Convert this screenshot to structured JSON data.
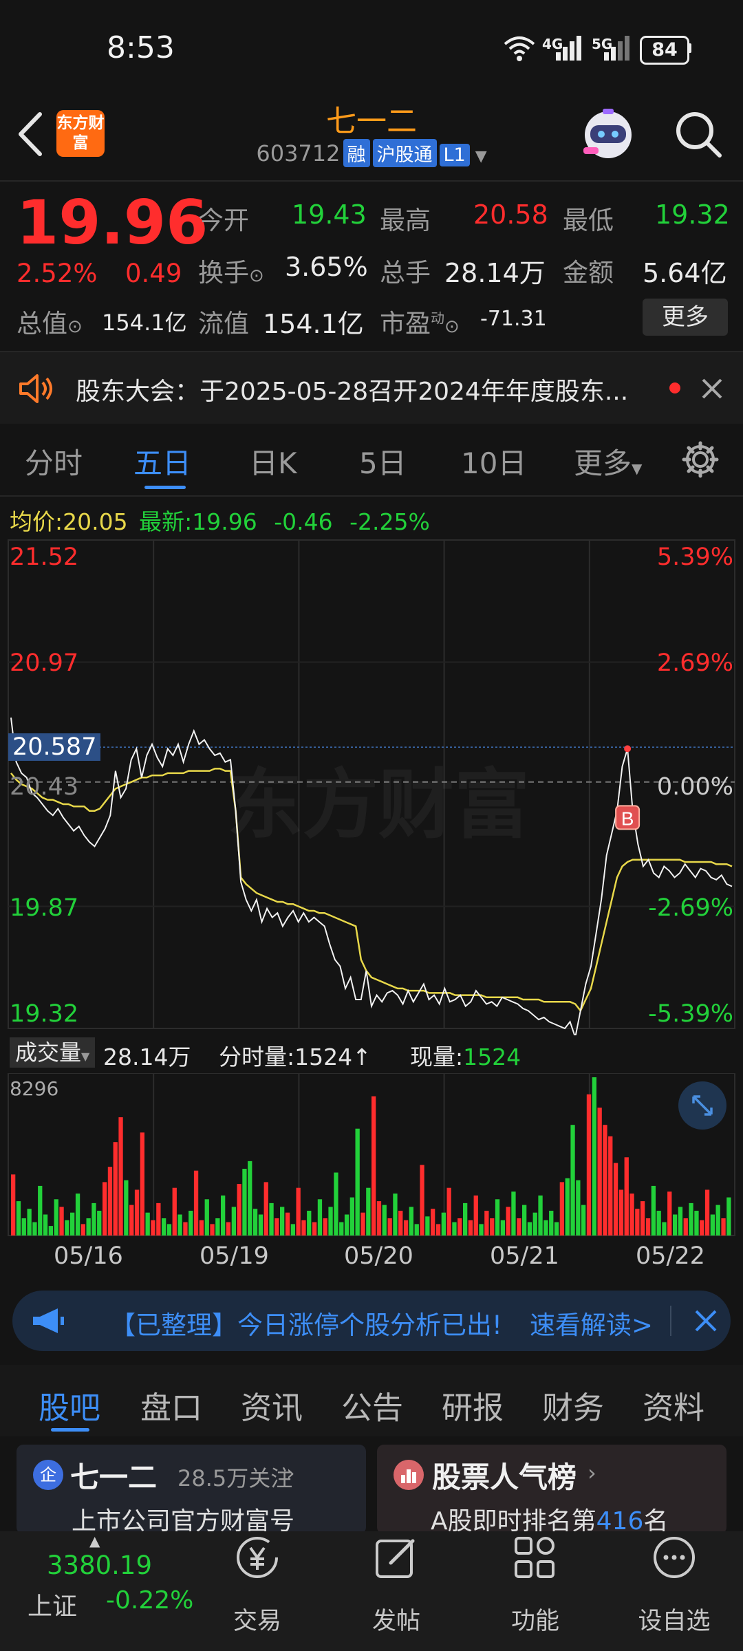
{
  "status_bar": {
    "time": "8:53",
    "battery": "84",
    "net1": "4G",
    "net2": "5G"
  },
  "header": {
    "stock_name": "七一二",
    "code": "603712",
    "tags": [
      "融",
      "沪股通",
      "L1"
    ],
    "logo_text": "东方财富"
  },
  "quote": {
    "price": "19.96",
    "change_pct": "2.52%",
    "change": "0.49",
    "fields": [
      {
        "label": "今开",
        "value": "19.43"
      },
      {
        "label": "最高",
        "value": "20.58"
      },
      {
        "label": "最低",
        "value": "19.32"
      },
      {
        "label": "换手",
        "value": "3.65%"
      },
      {
        "label": "总手",
        "value": "28.14万"
      },
      {
        "label": "金额",
        "value": "5.64亿"
      },
      {
        "label": "总值",
        "value": "154.1亿"
      },
      {
        "label": "流值",
        "value": "154.1亿"
      },
      {
        "label": "市盈",
        "sup": "动",
        "value": "-71.31"
      }
    ],
    "more_button": "更多"
  },
  "notice": {
    "text": "股东大会：于2025-05-28召开2024年年度股东..."
  },
  "chart_tabs": [
    "分时",
    "五日",
    "日K",
    "5日",
    "10日",
    "更多"
  ],
  "chart_tabs_active": "五日",
  "info_line": {
    "avg_label": "均价:",
    "avg_value": "20.05",
    "latest_label": "最新:",
    "latest_value": "19.96",
    "chg": "-0.46",
    "chg_pct": "-2.25%"
  },
  "watermark": "东方财富",
  "volume_header": {
    "dropdown": "成交量",
    "total": "28.14万",
    "tick_label": "分时量:1524↑",
    "now_label": "现量:",
    "now_value": "1524",
    "max_label": "8296"
  },
  "promo": {
    "text": "【已整理】今日涨停个股分析已出!",
    "link": "速看解读>"
  },
  "sub_tabs": [
    "股吧",
    "盘口",
    "资讯",
    "公告",
    "研报",
    "财务",
    "资料"
  ],
  "cards": [
    {
      "icon": "企",
      "title": "七一二",
      "meta": "28.5万关注",
      "sub": "上市公司官方财富号"
    },
    {
      "title": "股票人气榜",
      "sub_pre": "A股即时排名第",
      "rank": "416",
      "sub_post": "名"
    }
  ],
  "index": {
    "value": "3380.19",
    "name": "上证",
    "change": "-0.22%"
  },
  "nav": [
    "交易",
    "发帖",
    "功能",
    "设自选"
  ],
  "colors": {
    "up": "#ff2d2d",
    "down": "#22d13a",
    "accent": "#3d8ef7",
    "brand": "#ff9b1a",
    "avg_line": "#e8d84a"
  },
  "chart_data": {
    "type": "line",
    "title": "",
    "x_labels": [
      "05/16",
      "05/19",
      "05/20",
      "05/21",
      "05/22"
    ],
    "y_left_ticks": [
      "21.52",
      "20.97",
      "20.587",
      "20.43",
      "19.87",
      "19.32"
    ],
    "y_right_ticks": [
      "5.39%",
      "2.69%",
      "0.00%",
      "-2.69%",
      "-5.39%"
    ],
    "ylim": [
      19.32,
      21.52
    ],
    "prev_close": 20.43,
    "crosshair_value": 20.587,
    "series": [
      {
        "name": "价格",
        "values": [
          20.72,
          20.52,
          20.47,
          20.45,
          20.38,
          20.36,
          20.33,
          20.3,
          20.28,
          20.31,
          20.27,
          20.24,
          20.21,
          20.23,
          20.19,
          20.16,
          20.14,
          20.18,
          20.22,
          20.28,
          20.48,
          20.36,
          20.4,
          20.53,
          20.58,
          20.45,
          20.55,
          20.6,
          20.54,
          20.5,
          20.58,
          20.55,
          20.6,
          20.52,
          20.6,
          20.66,
          20.6,
          20.62,
          20.58,
          20.55,
          20.56,
          20.52,
          20.53,
          20.3,
          19.98,
          19.9,
          19.85,
          19.9,
          19.8,
          19.86,
          19.82,
          19.84,
          19.78,
          19.82,
          19.85,
          19.8,
          19.84,
          19.8,
          19.82,
          19.8,
          19.78,
          19.7,
          19.63,
          19.6,
          19.5,
          19.55,
          19.45,
          19.45,
          19.58,
          19.42,
          19.47,
          19.44,
          19.48,
          19.49,
          19.47,
          19.43,
          19.49,
          19.44,
          19.48,
          19.52,
          19.45,
          19.47,
          19.43,
          19.5,
          19.44,
          19.45,
          19.47,
          19.42,
          19.44,
          19.49,
          19.46,
          19.43,
          19.44,
          19.42,
          19.46,
          19.45,
          19.44,
          19.43,
          19.41,
          19.4,
          19.38,
          19.36,
          19.37,
          19.35,
          19.34,
          19.33,
          19.32,
          19.35,
          19.28,
          19.4,
          19.52,
          19.6,
          19.75,
          19.9,
          20.1,
          20.2,
          20.3,
          20.5,
          20.58,
          20.3,
          20.15,
          20.05,
          20.08,
          20.02,
          20.0,
          20.05,
          20.03,
          20.0,
          20.02,
          20.06,
          20.03,
          20.0,
          20.04,
          20.03,
          20.0,
          19.99,
          20.01,
          19.97,
          19.96
        ]
      },
      {
        "name": "均价",
        "values": [
          20.47,
          20.44,
          20.42,
          20.41,
          20.4,
          20.38,
          20.36,
          20.35,
          20.35,
          20.34,
          20.33,
          20.33,
          20.32,
          20.32,
          20.32,
          20.3,
          20.3,
          20.31,
          20.34,
          20.37,
          20.4,
          20.41,
          20.42,
          20.43,
          20.44,
          20.45,
          20.45,
          20.46,
          20.46,
          20.46,
          20.47,
          20.47,
          20.47,
          20.47,
          20.48,
          20.48,
          20.48,
          20.48,
          20.48,
          20.49,
          20.49,
          20.48,
          20.48,
          20.3,
          20.0,
          19.97,
          19.95,
          19.93,
          19.92,
          19.91,
          19.9,
          19.89,
          19.89,
          19.88,
          19.88,
          19.87,
          19.86,
          19.85,
          19.85,
          19.84,
          19.84,
          19.83,
          19.82,
          19.81,
          19.8,
          19.79,
          19.78,
          19.63,
          19.58,
          19.55,
          19.54,
          19.53,
          19.52,
          19.51,
          19.5,
          19.5,
          19.49,
          19.49,
          19.49,
          19.49,
          19.48,
          19.48,
          19.48,
          19.48,
          19.48,
          19.47,
          19.47,
          19.47,
          19.47,
          19.47,
          19.47,
          19.46,
          19.46,
          19.46,
          19.46,
          19.46,
          19.46,
          19.46,
          19.45,
          19.45,
          19.45,
          19.45,
          19.44,
          19.44,
          19.44,
          19.44,
          19.44,
          19.44,
          19.43,
          19.4,
          19.45,
          19.5,
          19.6,
          19.7,
          19.8,
          19.9,
          20.0,
          20.05,
          20.07,
          20.08,
          20.08,
          20.08,
          20.08,
          20.08,
          20.08,
          20.08,
          20.08,
          20.08,
          20.08,
          20.07,
          20.07,
          20.07,
          20.07,
          20.07,
          20.07,
          20.06,
          20.06,
          20.06,
          20.05
        ]
      }
    ],
    "volume": {
      "max": 8296,
      "values": [
        3200,
        1800,
        900,
        1400,
        700,
        2600,
        1100,
        500,
        1900,
        1500,
        800,
        1200,
        2200,
        600,
        900,
        1700,
        1300,
        2800,
        3600,
        4900,
        6200,
        2900,
        1600,
        2400,
        5400,
        1200,
        800,
        1700,
        900,
        600,
        2500,
        1100,
        700,
        1300,
        3400,
        800,
        1900,
        600,
        900,
        2100,
        700,
        1500,
        2700,
        3500,
        3900,
        1400,
        1100,
        2800,
        1700,
        900,
        1500,
        1200,
        600,
        2500,
        800,
        1300,
        700,
        1900,
        900,
        1500,
        3300,
        700,
        1100,
        2000,
        5600,
        1200,
        2500,
        7300,
        1800,
        1600,
        900,
        2200,
        1300,
        800,
        1500,
        600,
        3700,
        1000,
        1400,
        600,
        1200,
        2500,
        700,
        900,
        1700,
        800,
        2100,
        600,
        1300,
        900,
        1900,
        800,
        1500,
        2300,
        900,
        1600,
        700,
        1200,
        2100,
        800,
        1300,
        700,
        2800,
        3000,
        5800,
        2900,
        1600,
        7400,
        8296,
        6700,
        5800,
        5200,
        3800,
        2400,
        4100,
        2200,
        1400,
        1800,
        900,
        2600,
        1300,
        700,
        2300,
        1100,
        1500,
        900,
        1700,
        1300,
        800,
        2400,
        1100,
        1600,
        900,
        2000
      ]
    }
  }
}
